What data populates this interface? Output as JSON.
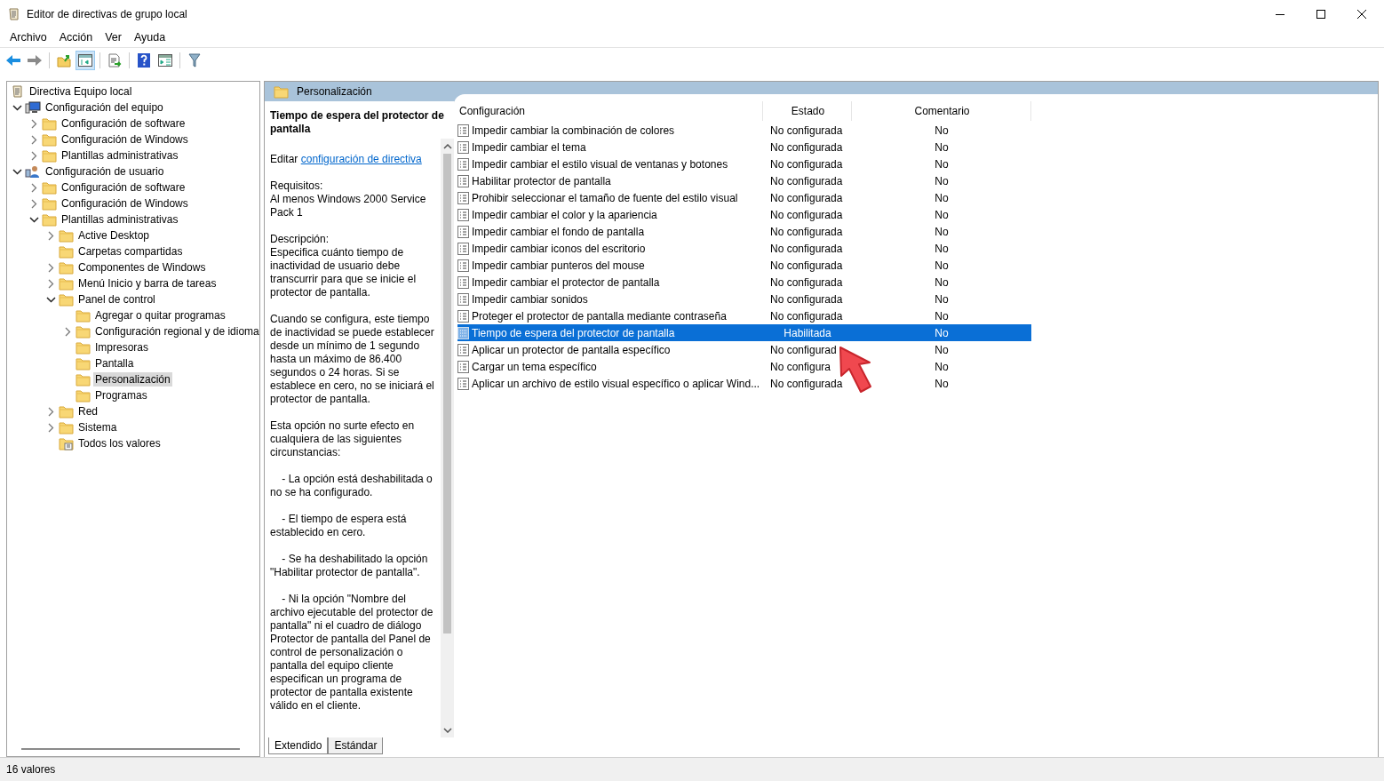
{
  "window": {
    "title": "Editor de directivas de grupo local"
  },
  "menu": [
    "Archivo",
    "Acción",
    "Ver",
    "Ayuda"
  ],
  "tree": {
    "root": {
      "label": "Directiva Equipo local",
      "kind": "policy",
      "selected": false,
      "expandable": false,
      "children": [
        {
          "label": "Configuración del equipo",
          "kind": "computer",
          "selected": false,
          "expandable": true,
          "expanded": true,
          "children": [
            {
              "label": "Configuración de software",
              "kind": "folder",
              "selected": false,
              "expandable": true,
              "expanded": false
            },
            {
              "label": "Configuración de Windows",
              "kind": "folder",
              "selected": false,
              "expandable": true,
              "expanded": false
            },
            {
              "label": "Plantillas administrativas",
              "kind": "folder",
              "selected": false,
              "expandable": true,
              "expanded": false
            }
          ]
        },
        {
          "label": "Configuración de usuario",
          "kind": "user",
          "selected": false,
          "expandable": true,
          "expanded": true,
          "children": [
            {
              "label": "Configuración de software",
              "kind": "folder",
              "selected": false,
              "expandable": true,
              "expanded": false
            },
            {
              "label": "Configuración de Windows",
              "kind": "folder",
              "selected": false,
              "expandable": true,
              "expanded": false
            },
            {
              "label": "Plantillas administrativas",
              "kind": "folder",
              "selected": false,
              "expandable": true,
              "expanded": true,
              "children": [
                {
                  "label": "Active Desktop",
                  "kind": "folder",
                  "selected": false,
                  "expandable": true,
                  "expanded": false
                },
                {
                  "label": "Carpetas compartidas",
                  "kind": "folder",
                  "selected": false,
                  "expandable": false
                },
                {
                  "label": "Componentes de Windows",
                  "kind": "folder",
                  "selected": false,
                  "expandable": true,
                  "expanded": false
                },
                {
                  "label": "Menú Inicio y barra de tareas",
                  "kind": "folder",
                  "selected": false,
                  "expandable": true,
                  "expanded": false
                },
                {
                  "label": "Panel de control",
                  "kind": "folder",
                  "selected": false,
                  "expandable": true,
                  "expanded": true,
                  "children": [
                    {
                      "label": "Agregar o quitar programas",
                      "kind": "folder",
                      "selected": false,
                      "expandable": false
                    },
                    {
                      "label": "Configuración regional y de idioma",
                      "kind": "folder",
                      "selected": false,
                      "expandable": true,
                      "expanded": false
                    },
                    {
                      "label": "Impresoras",
                      "kind": "folder",
                      "selected": false,
                      "expandable": false
                    },
                    {
                      "label": "Pantalla",
                      "kind": "folder",
                      "selected": false,
                      "expandable": false
                    },
                    {
                      "label": "Personalización",
                      "kind": "folder",
                      "selected": true,
                      "expandable": false
                    },
                    {
                      "label": "Programas",
                      "kind": "folder",
                      "selected": false,
                      "expandable": false
                    }
                  ]
                },
                {
                  "label": "Red",
                  "kind": "folder",
                  "selected": false,
                  "expandable": true,
                  "expanded": false
                },
                {
                  "label": "Sistema",
                  "kind": "folder",
                  "selected": false,
                  "expandable": true,
                  "expanded": false
                },
                {
                  "label": "Todos los valores",
                  "kind": "settings",
                  "selected": false,
                  "expandable": false
                }
              ]
            }
          ]
        }
      ]
    }
  },
  "header": {
    "title": "Personalización"
  },
  "details": {
    "title": "Tiempo de espera del protector de pantalla",
    "edit_prefix": "Editar",
    "edit_link": "configuración de directiva",
    "paragraphs": [
      "Requisitos:\nAl menos Windows 2000 Service Pack 1",
      "Descripción:\nEspecifica cuánto tiempo de inactividad de usuario debe transcurrir para que se inicie el protector de pantalla.",
      "Cuando se configura, este tiempo de inactividad se puede establecer desde un mínimo de 1 segundo hasta un máximo de 86.400 segundos o 24 horas. Si se establece en cero, no se iniciará el protector de pantalla.",
      "Esta opción no surte efecto en cualquiera de las siguientes circunstancias:",
      "    - La opción está deshabilitada o no se ha configurado.",
      "    - El tiempo de espera está establecido en cero.",
      "    - Se ha deshabilitado la opción \"Habilitar protector de pantalla\".",
      "    - Ni la opción \"Nombre del archivo ejecutable del protector de pantalla\" ni el cuadro de diálogo Protector de pantalla del Panel de control de personalización o pantalla del equipo cliente especifican un programa de protector de pantalla existente válido en el cliente."
    ]
  },
  "table": {
    "columns": [
      "Configuración",
      "Estado",
      "Comentario"
    ],
    "rows": [
      {
        "name": "Impedir cambiar la combinación de colores",
        "state": "No configurada",
        "comment": "No",
        "selected": false
      },
      {
        "name": "Impedir cambiar el tema",
        "state": "No configurada",
        "comment": "No",
        "selected": false
      },
      {
        "name": "Impedir cambiar el estilo visual de ventanas y botones",
        "state": "No configurada",
        "comment": "No",
        "selected": false
      },
      {
        "name": "Habilitar protector de pantalla",
        "state": "No configurada",
        "comment": "No",
        "selected": false
      },
      {
        "name": "Prohibir seleccionar el tamaño de fuente del estilo visual",
        "state": "No configurada",
        "comment": "No",
        "selected": false
      },
      {
        "name": "Impedir cambiar el color y la apariencia",
        "state": "No configurada",
        "comment": "No",
        "selected": false
      },
      {
        "name": "Impedir cambiar el fondo de pantalla",
        "state": "No configurada",
        "comment": "No",
        "selected": false
      },
      {
        "name": "Impedir cambiar iconos del escritorio",
        "state": "No configurada",
        "comment": "No",
        "selected": false
      },
      {
        "name": "Impedir cambiar punteros del mouse",
        "state": "No configurada",
        "comment": "No",
        "selected": false
      },
      {
        "name": "Impedir cambiar el protector de pantalla",
        "state": "No configurada",
        "comment": "No",
        "selected": false
      },
      {
        "name": "Impedir cambiar sonidos",
        "state": "No configurada",
        "comment": "No",
        "selected": false
      },
      {
        "name": "Proteger el protector de pantalla mediante contraseña",
        "state": "No configurada",
        "comment": "No",
        "selected": false
      },
      {
        "name": "Tiempo de espera del protector de pantalla",
        "state": "Habilitada",
        "comment": "No",
        "selected": true
      },
      {
        "name": "Aplicar un protector de pantalla específico",
        "state": "No configurad",
        "comment": "No",
        "selected": false
      },
      {
        "name": "Cargar un tema específico",
        "state": "No configura",
        "comment": "No",
        "selected": false
      },
      {
        "name": "Aplicar un archivo de estilo visual específico o aplicar Wind...",
        "state": "No configurada",
        "comment": "No",
        "selected": false
      }
    ]
  },
  "tabs": [
    {
      "label": "Extendido",
      "selected": true
    },
    {
      "label": "Estándar",
      "selected": false
    }
  ],
  "status_bar": {
    "text": "16 valores"
  }
}
